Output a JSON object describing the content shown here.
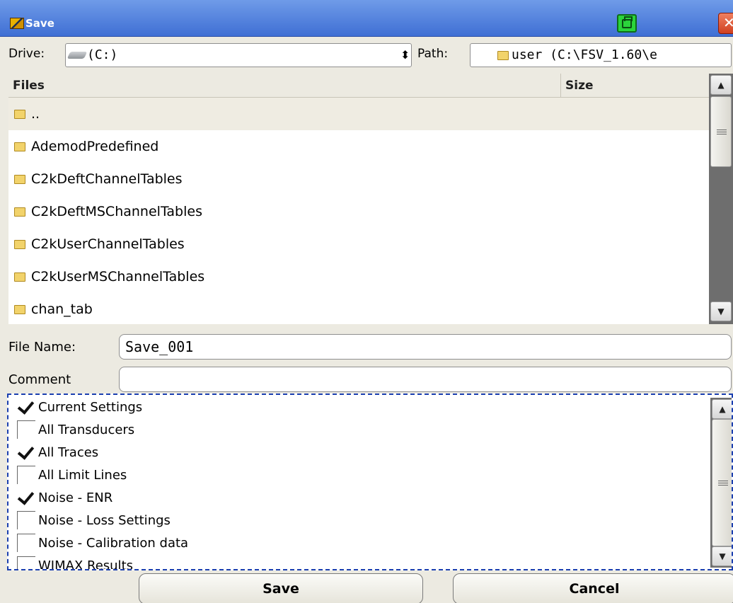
{
  "window": {
    "title": "Save",
    "print_icon": "printer-icon",
    "close_label": "✕"
  },
  "drive": {
    "label": "Drive:",
    "value": "(C:)"
  },
  "path": {
    "label": "Path:",
    "value": "user  (C:\\FSV_1.60\\e"
  },
  "file_list": {
    "columns": [
      "Files",
      "Size"
    ],
    "rows": [
      {
        "name": "..",
        "size": ""
      },
      {
        "name": "AdemodPredefined",
        "size": ""
      },
      {
        "name": "C2kDeftChannelTables",
        "size": ""
      },
      {
        "name": "C2kDeftMSChannelTables",
        "size": ""
      },
      {
        "name": "C2kUserChannelTables",
        "size": ""
      },
      {
        "name": "C2kUserMSChannelTables",
        "size": ""
      },
      {
        "name": "chan_tab",
        "size": ""
      }
    ]
  },
  "file_name": {
    "label": "File Name:",
    "value": "Save_001"
  },
  "comment": {
    "label": "Comment",
    "value": ""
  },
  "options": [
    {
      "label": "Current Settings",
      "checked": true
    },
    {
      "label": "All Transducers",
      "checked": false
    },
    {
      "label": "All Traces",
      "checked": true
    },
    {
      "label": "All Limit Lines",
      "checked": false
    },
    {
      "label": "Noise - ENR",
      "checked": true
    },
    {
      "label": "Noise - Loss Settings",
      "checked": false
    },
    {
      "label": "Noise - Calibration data",
      "checked": false
    },
    {
      "label": "WIMAX Results",
      "checked": false
    }
  ],
  "buttons": {
    "save": "Save",
    "cancel": "Cancel"
  },
  "colors": {
    "title_bar": "#3f6fd4",
    "dialog_bg": "#eceae1",
    "focus_border": "#1b3fb0",
    "scrollbar_track": "#6e6e6e"
  }
}
